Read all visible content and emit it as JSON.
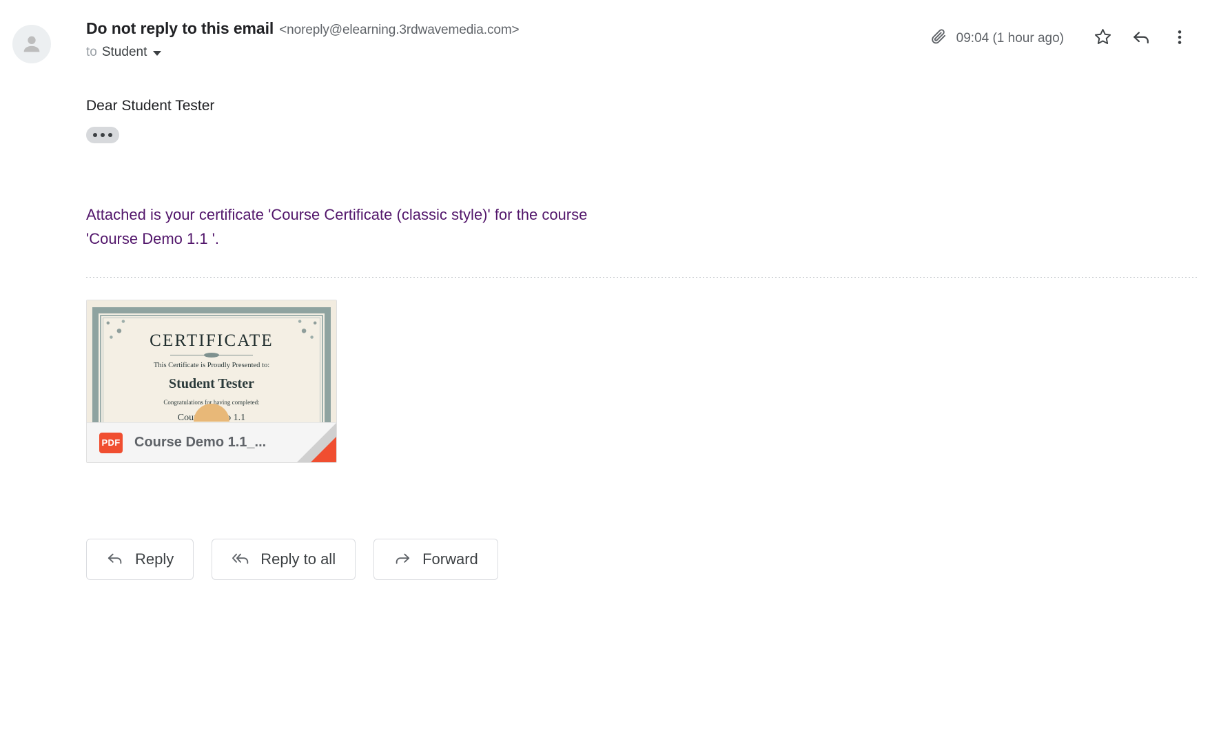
{
  "header": {
    "avatar_icon": "person-avatar-icon",
    "sender_name": "Do not reply to this email",
    "sender_email": "<noreply@elearning.3rdwavemedia.com>",
    "recipient_prefix": "to",
    "recipient_name": "Student",
    "details_caret_icon": "caret-down-icon",
    "attachment_icon": "paperclip-icon",
    "timestamp": "09:04 (1 hour ago)",
    "star_icon": "star-outline-icon",
    "reply_icon": "reply-arrow-icon",
    "more_icon": "more-vertical-icon"
  },
  "body": {
    "greeting": "Dear Student Tester",
    "trimmed_content_icon": "ellipsis-icon",
    "message_line_1": "Attached is your certificate 'Course Certificate (classic style)' for the",
    "message_line_2": "course 'Course Demo 1.1 '."
  },
  "attachment": {
    "filename": "Course Demo 1.1_...",
    "file_type_badge": "PDF",
    "file_type_icon": "pdf-file-icon",
    "preview": {
      "title": "CERTIFICATE",
      "presented_to_label": "This Certificate is Proudly Presented to:",
      "recipient": "Student Tester",
      "congrats_label": "Congratulations for having completed:",
      "course": "Course Demo 1.1"
    }
  },
  "actions": [
    {
      "label": "Reply",
      "icon": "reply-arrow-icon"
    },
    {
      "label": "Reply to all",
      "icon": "reply-all-arrow-icon"
    },
    {
      "label": "Forward",
      "icon": "forward-arrow-icon"
    }
  ],
  "colors": {
    "accent_purple": "#52166b",
    "pdf_red": "#f04e30",
    "text_primary": "#202124",
    "text_secondary": "#5f6368"
  }
}
